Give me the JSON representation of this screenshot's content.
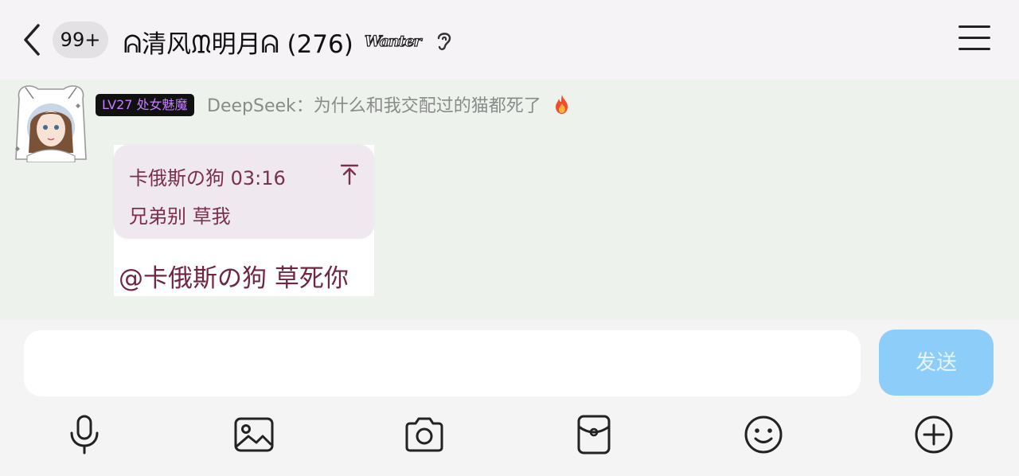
{
  "header": {
    "unread_badge": "99+",
    "title": "ᕱ清风ᙢ明月ᕱ (276)",
    "title_tag": "Wanter",
    "back_icon": "chevron-left-icon",
    "ear_icon": "ear-icon",
    "menu_icon": "hamburger-menu-icon"
  },
  "message": {
    "level_badge": "LV27 处女魅魔",
    "sender_line": "DeepSeek：为什么和我交配过的猫都死了",
    "fire_icon": "fire-icon",
    "quote": {
      "header": "卡俄斯の狗 03:16",
      "body": "兄弟别 草我",
      "arrow_icon": "arrow-up-icon"
    },
    "reply_text": "@卡俄斯の狗 草死你"
  },
  "composer": {
    "input_value": "",
    "send_label": "发送",
    "tools": [
      "microphone-icon",
      "image-icon",
      "camera-icon",
      "red-packet-icon",
      "emoji-icon",
      "plus-circle-icon"
    ]
  },
  "colors": {
    "accent_blue": "#8ccdf9",
    "quote_text": "#7a2f4a",
    "level_text": "#c77dff"
  }
}
